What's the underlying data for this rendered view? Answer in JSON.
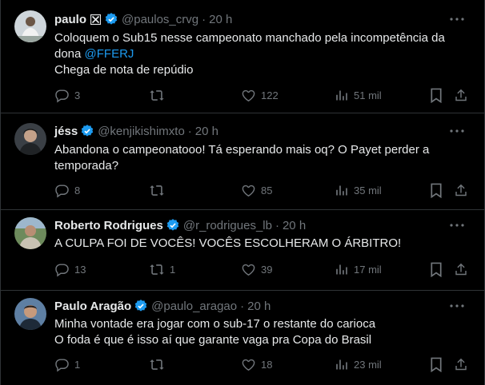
{
  "tweets": [
    {
      "name": "paulo",
      "handle": "@paulos_crvg",
      "time": "20 h",
      "lines": [
        "Coloquem o Sub15 nesse campeonato manchado pela incompetência da",
        "dona ",
        "Chega de nota de repúdio"
      ],
      "mention": "@FFERJ",
      "replies": "3",
      "reposts": "",
      "likes": "122",
      "views": "51 mil"
    },
    {
      "name": "jéss",
      "handle": "@kenjikishimxto",
      "time": "20 h",
      "lines": [
        "Abandona o campeonatooo! Tá esperando mais oq? O Payet perder a",
        "temporada?"
      ],
      "replies": "8",
      "reposts": "",
      "likes": "85",
      "views": "35 mil"
    },
    {
      "name": "Roberto Rodrigues",
      "handle": "@r_rodrigues_lb",
      "time": "20 h",
      "lines": [
        "A CULPA FOI DE VOCÊS! VOCÊS ESCOLHERAM O ÁRBITRO!"
      ],
      "replies": "13",
      "reposts": "1",
      "likes": "39",
      "views": "17 mil"
    },
    {
      "name": "Paulo Aragão",
      "handle": "@paulo_aragao",
      "time": "20 h",
      "lines": [
        "Minha vontade era jogar com o sub-17 o restante do carioca",
        "O foda é que é isso aí que garante vaga pra Copa do Brasil"
      ],
      "replies": "1",
      "reposts": "",
      "likes": "18",
      "views": "23 mil"
    }
  ],
  "dot": "·",
  "colors": {
    "background": "#000000",
    "text": "#e7e9ea",
    "muted": "#71767b",
    "accent": "#1d9bf0",
    "divider": "#2f3336"
  },
  "icons": [
    "verified-badge-icon",
    "more-icon",
    "reply-icon",
    "repost-icon",
    "like-icon",
    "views-icon",
    "bookmark-icon",
    "share-icon",
    "cross-badge-icon"
  ]
}
